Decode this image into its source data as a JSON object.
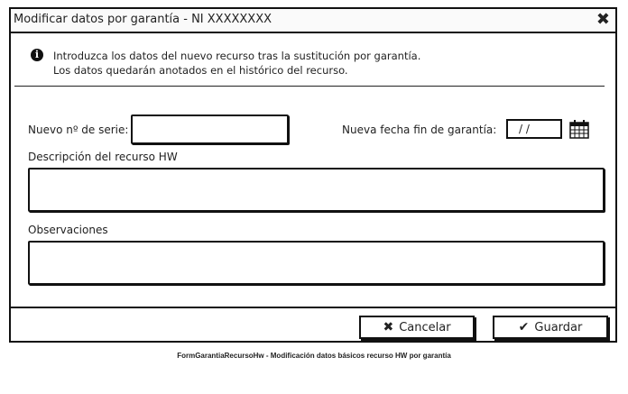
{
  "dialog": {
    "title": "Modificar datos por garantía - NI XXXXXXXX",
    "close_glyph": "✖"
  },
  "info": {
    "icon": "info-icon",
    "line1": "Introduzca los datos del nuevo recurso tras la sustitución por garantía.",
    "line2": "Los datos quedarán anotados en el histórico del recurso."
  },
  "form": {
    "serial_label": "Nuevo nº de serie:",
    "serial_value": "",
    "warranty_end_label": "Nueva fecha fin de garantía:",
    "warranty_end_value": "/ /",
    "description_label": "Descripción del recurso HW",
    "description_value": "",
    "observations_label": "Observaciones",
    "observations_value": ""
  },
  "buttons": {
    "cancel_label": "Cancelar",
    "save_label": "Guardar"
  },
  "caption": "FormGarantiaRecursoHw - Modificación datos básicos recurso HW por garantía"
}
